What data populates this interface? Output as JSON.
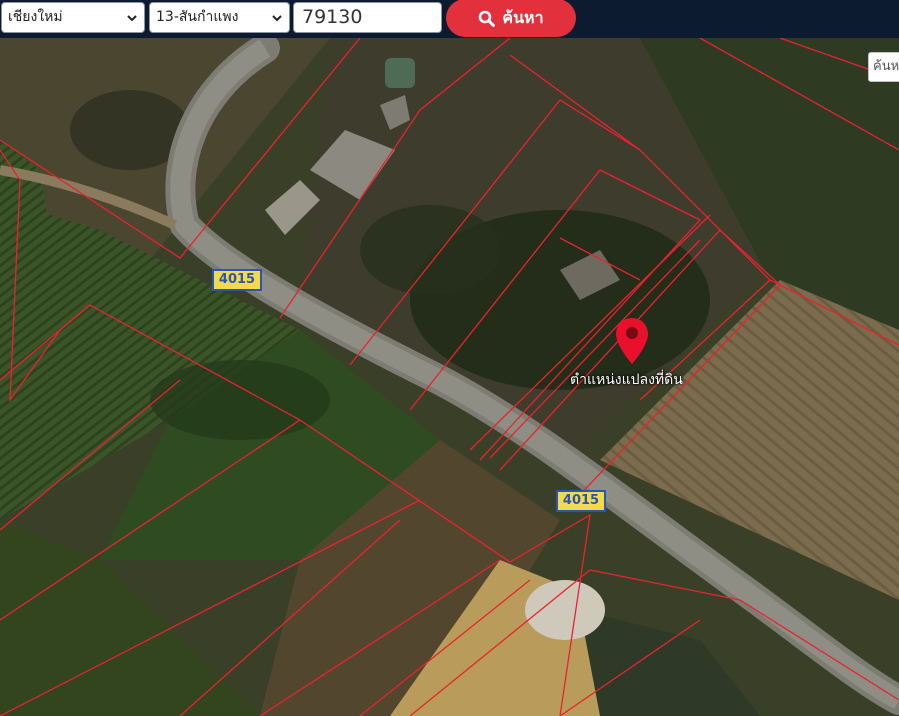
{
  "search": {
    "province": "เชียงใหม่",
    "district": "13-สันกำแพง",
    "postcode": "79130",
    "button_label": "ค้นหา",
    "button_icon": "search-icon",
    "side_search_placeholder": "ค้นห"
  },
  "map": {
    "road_shields": [
      "4015",
      "4015"
    ],
    "marker_label": "ตำแหน่งแปลงที่ดิน",
    "marker_icon": "map-pin-icon",
    "parcel_line_color": "#e8232d",
    "marker_color": "#e8102a",
    "shield_fill": "#f4d94a",
    "shield_border": "#2a55b4"
  },
  "colors": {
    "topbar": "#0d1b30",
    "search_button": "#e2303d"
  }
}
